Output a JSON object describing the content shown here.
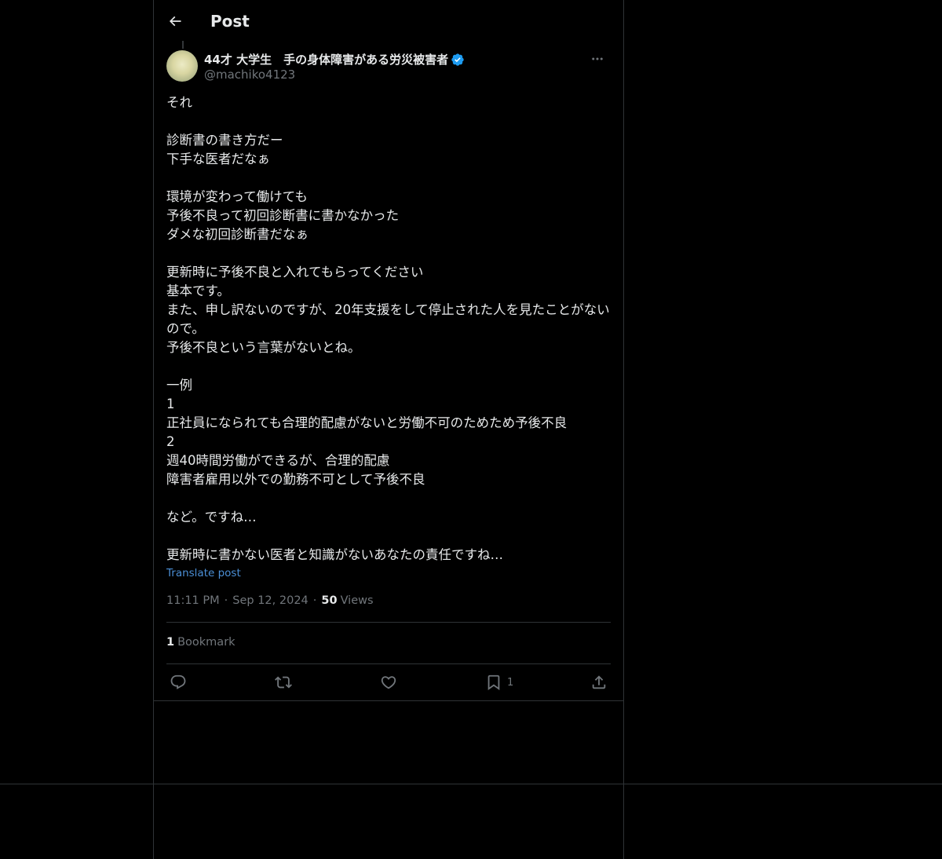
{
  "header": {
    "back_icon": "arrow-left-icon",
    "title": "Post"
  },
  "author": {
    "display_name": "44才 大学生　手の身体障害がある労災被害者",
    "verified_icon": "verified-badge-icon",
    "verified_color": "#1d9bf0",
    "handle": "@machiko4123",
    "more_icon": "more-horizontal-icon"
  },
  "post": {
    "text": "それ\n\n診断書の書き方だー\n下手な医者だなぁ\n\n環境が変わって働けても\n予後不良って初回診断書に書かなかった\nダメな初回診断書だなぁ\n\n更新時に予後不良と入れてもらってください\n基本です。\nまた、申し訳ないのですが、20年支援をして停止された人を見たことがないので。\n予後不良という言葉がないとね。\n\n一例\n1\n正社員になられても合理的配慮がないと労働不可のためため予後不良\n2\n週40時間労働ができるが、合理的配慮\n障害者雇用以外での勤務不可として予後不良\n\nなど。ですね…\n\n更新時に書かない医者と知識がないあなたの責任ですね…",
    "translate_label": "Translate post",
    "time": "11:11 PM",
    "separator": "·",
    "date": "Sep 12, 2024",
    "views_count": "50",
    "views_label": "Views"
  },
  "stats": {
    "bookmark_count": "1",
    "bookmark_label": "Bookmark"
  },
  "actions": {
    "reply_icon": "reply-icon",
    "repost_icon": "repost-icon",
    "like_icon": "heart-icon",
    "bookmark_icon": "bookmark-icon",
    "bookmark_count": "1",
    "share_icon": "share-icon"
  },
  "colors": {
    "background": "#000000",
    "text": "#e7e9ea",
    "secondary_text": "#71767b",
    "link": "#4b8fd6",
    "border": "#2f3336"
  }
}
